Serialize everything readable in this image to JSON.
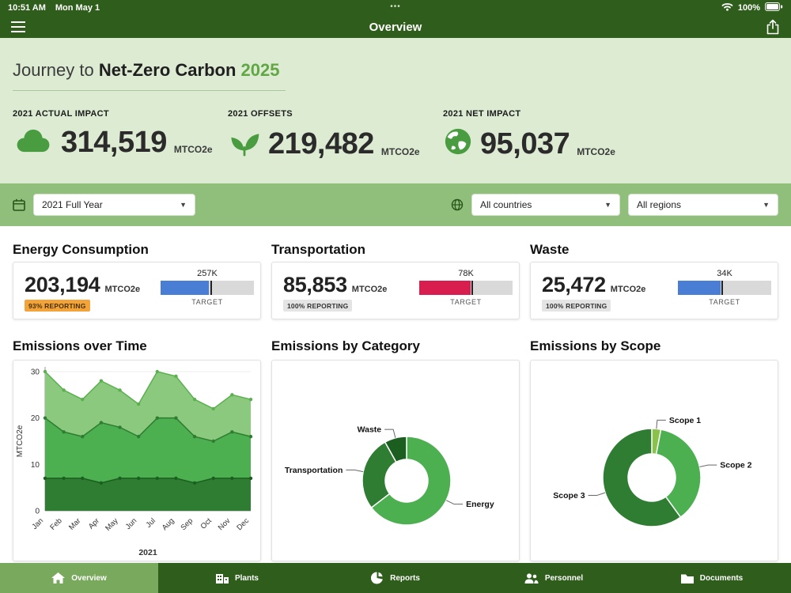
{
  "colors": {
    "header_green": "#2F5D1B",
    "hero_bg": "#DCEBD2",
    "filter_bg": "#90BF7C",
    "accent_green": "#61A744",
    "active_tab_green": "#78A95C",
    "kpi_icon_green": "#4A9C41"
  },
  "status_bar": {
    "time": "10:51 AM",
    "date": "Mon May 1",
    "handle": "•••",
    "battery": "100%"
  },
  "nav": {
    "title": "Overview"
  },
  "hero": {
    "title_prefix": "Journey to ",
    "title_em": "Net-Zero Carbon",
    "title_year": "2025",
    "kpis": [
      {
        "label": "2021 ACTUAL IMPACT",
        "value": "314,519",
        "unit": "MTCO2e",
        "icon": "cloud-icon"
      },
      {
        "label": "2021 OFFSETS",
        "value": "219,482",
        "unit": "MTCO2e",
        "icon": "seedling-icon"
      },
      {
        "label": "2021 NET IMPACT",
        "value": "95,037",
        "unit": "MTCO2e",
        "icon": "globe-icon"
      }
    ]
  },
  "filters": {
    "period": "2021 Full Year",
    "country": "All countries",
    "region": "All regions"
  },
  "metrics": [
    {
      "title": "Energy Consumption",
      "value": "203,194",
      "unit": "MTCO2e",
      "badge": {
        "text": "93% REPORTING",
        "bg": "#F2A43B",
        "fg": "#4A3000"
      },
      "target_value": "257K",
      "target_word": "TARGET",
      "bar": {
        "color": "#4A7ED4",
        "fill_pct": 52,
        "marker_pct": 53
      }
    },
    {
      "title": "Transportation",
      "value": "85,853",
      "unit": "MTCO2e",
      "badge": {
        "text": "100% REPORTING",
        "bg": "#E4E4E4",
        "fg": "#333333"
      },
      "target_value": "78K",
      "target_word": "TARGET",
      "bar": {
        "color": "#D81E4E",
        "fill_pct": 55,
        "marker_pct": 56
      }
    },
    {
      "title": "Waste",
      "value": "25,472",
      "unit": "MTCO2e",
      "badge": {
        "text": "100% REPORTING",
        "bg": "#E4E4E4",
        "fg": "#333333"
      },
      "target_value": "34K",
      "target_word": "TARGET",
      "bar": {
        "color": "#4A7ED4",
        "fill_pct": 46,
        "marker_pct": 47
      }
    }
  ],
  "chart_data": [
    {
      "id": "emissions-over-time",
      "type": "area",
      "title": "Emissions over Time",
      "xlabel": "2021",
      "ylabel": "MTCO2e",
      "ylim": [
        0,
        30
      ],
      "yticks": [
        0,
        10,
        20,
        30
      ],
      "categories": [
        "Jan",
        "Feb",
        "Mar",
        "Apr",
        "May",
        "Jun",
        "Jul",
        "Aug",
        "Sep",
        "Oct",
        "Nov",
        "Dec"
      ],
      "series": [
        {
          "name": "band-light (total)",
          "fill": "#8BC97E",
          "stroke": "#5BB04F",
          "values": [
            30,
            26,
            24,
            28,
            26,
            23,
            30,
            29,
            24,
            22,
            25,
            24
          ]
        },
        {
          "name": "band-mid",
          "fill": "#4CAF50",
          "stroke": "#2E7D32",
          "values": [
            20,
            17,
            16,
            19,
            18,
            16,
            20,
            20,
            16,
            15,
            17,
            16
          ]
        },
        {
          "name": "band-dark",
          "fill": "#2E7D32",
          "stroke": "#1B5E20",
          "values": [
            7,
            7,
            7,
            6,
            7,
            7,
            7,
            7,
            6,
            7,
            7,
            7
          ]
        }
      ]
    },
    {
      "id": "emissions-by-category",
      "type": "donut",
      "title": "Emissions by Category",
      "slices": [
        {
          "label": "Energy",
          "value": 203194,
          "color": "#4CAF50"
        },
        {
          "label": "Transportation",
          "value": 85853,
          "color": "#2E7D32"
        },
        {
          "label": "Waste",
          "value": 25472,
          "color": "#1B5E20"
        }
      ]
    },
    {
      "id": "emissions-by-scope",
      "type": "donut",
      "title": "Emissions by Scope",
      "slices": [
        {
          "label": "Scope 1",
          "value": 3,
          "color": "#8BC34A"
        },
        {
          "label": "Scope 2",
          "value": 37,
          "color": "#4CAF50"
        },
        {
          "label": "Scope 3",
          "value": 60,
          "color": "#2E7D32"
        }
      ]
    }
  ],
  "tabbar": {
    "tabs": [
      {
        "label": "Overview",
        "icon": "home-icon",
        "active": true
      },
      {
        "label": "Plants",
        "icon": "factory-icon",
        "active": false
      },
      {
        "label": "Reports",
        "icon": "pie-chart-icon",
        "active": false
      },
      {
        "label": "Personnel",
        "icon": "people-icon",
        "active": false
      },
      {
        "label": "Documents",
        "icon": "folder-icon",
        "active": false
      }
    ]
  }
}
